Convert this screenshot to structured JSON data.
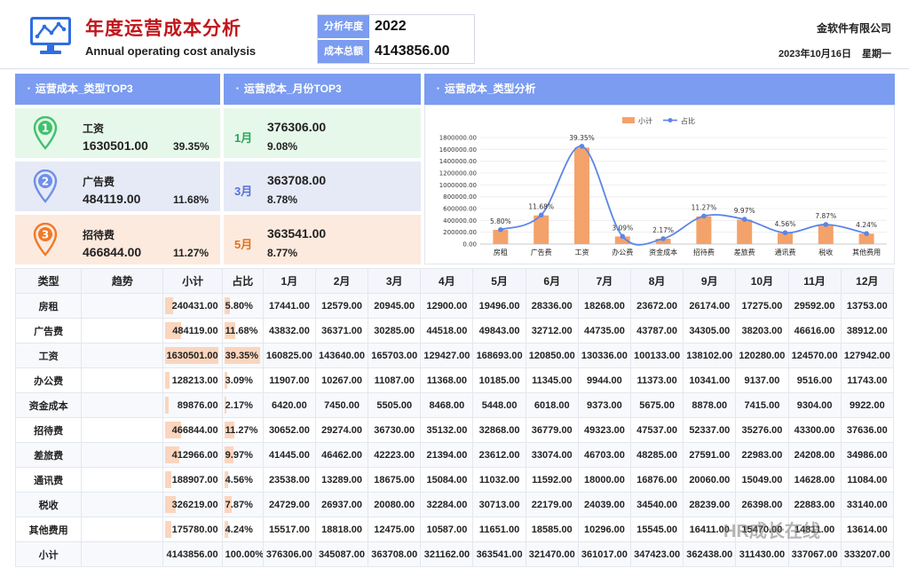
{
  "header": {
    "title": "年度运营成本分析",
    "subtitle": "Annual operating cost analysis",
    "year_label": "分析年度",
    "year_value": "2022",
    "total_label": "成本总额",
    "total_value": "4143856.00",
    "company": "金软件有限公司",
    "date": "2023年10月16日",
    "weekday": "星期一",
    "logo_icon": "line-chart-monitor-icon"
  },
  "panels": {
    "type_top3": "运营成本_类型TOP3",
    "month_top3": "运营成本_月份TOP3",
    "type_analysis": "运营成本_类型分析"
  },
  "type_top": [
    {
      "name": "工资",
      "value": "1630501.00",
      "pct": "39.35%",
      "icon": "map-pin-1-icon",
      "color": "#3fc26b"
    },
    {
      "name": "广告费",
      "value": "484119.00",
      "pct": "11.68%",
      "icon": "map-pin-2-icon",
      "color": "#6f8fe8"
    },
    {
      "name": "招待费",
      "value": "466844.00",
      "pct": "11.27%",
      "icon": "map-pin-3-icon",
      "color": "#f07a28"
    }
  ],
  "month_top": [
    {
      "month": "1月",
      "value": "376306.00",
      "pct": "9.08%",
      "color": "#2aa65a"
    },
    {
      "month": "3月",
      "value": "363708.00",
      "pct": "8.78%",
      "color": "#5572d8"
    },
    {
      "month": "5月",
      "value": "363541.00",
      "pct": "8.77%",
      "color": "#e0731f"
    }
  ],
  "chart_data": {
    "type": "bar",
    "categories": [
      "房租",
      "广告费",
      "工资",
      "办公费",
      "资金成本",
      "招待费",
      "差旅费",
      "通讯费",
      "税收",
      "其他费用"
    ],
    "series": [
      {
        "name": "小计",
        "type": "bar",
        "values": [
          240431,
          484119,
          1630501,
          128213,
          89876,
          466844,
          412966,
          188907,
          326219,
          175780
        ],
        "color": "#f4a26b"
      },
      {
        "name": "占比",
        "type": "line",
        "values": [
          5.8,
          11.68,
          39.35,
          3.09,
          2.17,
          11.27,
          9.97,
          4.56,
          7.87,
          4.24
        ],
        "labels": [
          "5.80%",
          "11.68%",
          "39.35%",
          "3.09%",
          "2.17%",
          "11.27%",
          "9.97%",
          "4.56%",
          "7.87%",
          "4.24%"
        ],
        "color": "#5b86e6"
      }
    ],
    "yticks": [
      "1800000.00",
      "1600000.00",
      "1400000.00",
      "1200000.00",
      "1000000.00",
      "800000.00",
      "600000.00",
      "400000.00",
      "200000.00",
      "0.00"
    ],
    "ylim": [
      0,
      1800000
    ],
    "legend_position": "top",
    "grid": true
  },
  "table": {
    "headers": [
      "类型",
      "趋势",
      "小计",
      "占比",
      "1月",
      "2月",
      "3月",
      "4月",
      "5月",
      "6月",
      "7月",
      "8月",
      "9月",
      "10月",
      "11月",
      "12月"
    ],
    "max_subtotal": 1630501,
    "rows": [
      {
        "type": "房租",
        "subtotal": "240431.00",
        "share": "5.80%",
        "share_num": 5.8,
        "sub_num": 240431,
        "months": [
          "17441.00",
          "12579.00",
          "20945.00",
          "12900.00",
          "19496.00",
          "28336.00",
          "18268.00",
          "23672.00",
          "26174.00",
          "17275.00",
          "29592.00",
          "13753.00"
        ]
      },
      {
        "type": "广告费",
        "subtotal": "484119.00",
        "share": "11.68%",
        "share_num": 11.68,
        "sub_num": 484119,
        "months": [
          "43832.00",
          "36371.00",
          "30285.00",
          "44518.00",
          "49843.00",
          "32712.00",
          "44735.00",
          "43787.00",
          "34305.00",
          "38203.00",
          "46616.00",
          "38912.00"
        ]
      },
      {
        "type": "工资",
        "subtotal": "1630501.00",
        "share": "39.35%",
        "share_num": 39.35,
        "sub_num": 1630501,
        "months": [
          "160825.00",
          "143640.00",
          "165703.00",
          "129427.00",
          "168693.00",
          "120850.00",
          "130336.00",
          "100133.00",
          "138102.00",
          "120280.00",
          "124570.00",
          "127942.00"
        ]
      },
      {
        "type": "办公费",
        "subtotal": "128213.00",
        "share": "3.09%",
        "share_num": 3.09,
        "sub_num": 128213,
        "months": [
          "11907.00",
          "10267.00",
          "11087.00",
          "11368.00",
          "10185.00",
          "11345.00",
          "9944.00",
          "11373.00",
          "10341.00",
          "9137.00",
          "9516.00",
          "11743.00"
        ]
      },
      {
        "type": "资金成本",
        "subtotal": "89876.00",
        "share": "2.17%",
        "share_num": 2.17,
        "sub_num": 89876,
        "months": [
          "6420.00",
          "7450.00",
          "5505.00",
          "8468.00",
          "5448.00",
          "6018.00",
          "9373.00",
          "5675.00",
          "8878.00",
          "7415.00",
          "9304.00",
          "9922.00"
        ]
      },
      {
        "type": "招待费",
        "subtotal": "466844.00",
        "share": "11.27%",
        "share_num": 11.27,
        "sub_num": 466844,
        "months": [
          "30652.00",
          "29274.00",
          "36730.00",
          "35132.00",
          "32868.00",
          "36779.00",
          "49323.00",
          "47537.00",
          "52337.00",
          "35276.00",
          "43300.00",
          "37636.00"
        ]
      },
      {
        "type": "差旅费",
        "subtotal": "412966.00",
        "share": "9.97%",
        "share_num": 9.97,
        "sub_num": 412966,
        "months": [
          "41445.00",
          "46462.00",
          "42223.00",
          "21394.00",
          "23612.00",
          "33074.00",
          "46703.00",
          "48285.00",
          "27591.00",
          "22983.00",
          "24208.00",
          "34986.00"
        ]
      },
      {
        "type": "通讯费",
        "subtotal": "188907.00",
        "share": "4.56%",
        "share_num": 4.56,
        "sub_num": 188907,
        "months": [
          "23538.00",
          "13289.00",
          "18675.00",
          "15084.00",
          "11032.00",
          "11592.00",
          "18000.00",
          "16876.00",
          "20060.00",
          "15049.00",
          "14628.00",
          "11084.00"
        ]
      },
      {
        "type": "税收",
        "subtotal": "326219.00",
        "share": "7.87%",
        "share_num": 7.87,
        "sub_num": 326219,
        "months": [
          "24729.00",
          "26937.00",
          "20080.00",
          "32284.00",
          "30713.00",
          "22179.00",
          "24039.00",
          "34540.00",
          "28239.00",
          "26398.00",
          "22883.00",
          "33140.00"
        ]
      },
      {
        "type": "其他费用",
        "subtotal": "175780.00",
        "share": "4.24%",
        "share_num": 4.24,
        "sub_num": 175780,
        "months": [
          "15517.00",
          "18818.00",
          "12475.00",
          "10587.00",
          "11651.00",
          "18585.00",
          "10296.00",
          "15545.00",
          "16411.00",
          "15470.00",
          "14811.00",
          "13614.00"
        ]
      },
      {
        "type": "小计",
        "subtotal": "4143856.00",
        "share": "100.00%",
        "share_num": 0,
        "sub_num": 0,
        "months": [
          "376306.00",
          "345087.00",
          "363708.00",
          "321162.00",
          "363541.00",
          "321470.00",
          "361017.00",
          "347423.00",
          "362438.00",
          "311430.00",
          "337067.00",
          "333207.00"
        ]
      }
    ]
  },
  "watermark": "HR成长在线"
}
